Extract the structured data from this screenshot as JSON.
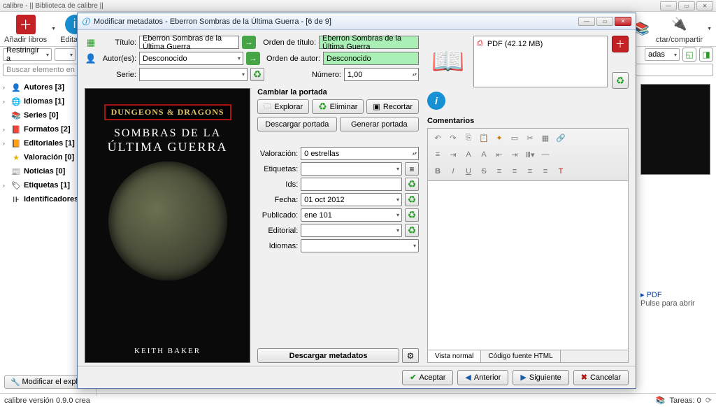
{
  "main_window": {
    "title": "calibre - || Biblioteca de calibre ||",
    "toolbar": {
      "add": "Añadir libros",
      "edit": "Editar m"
    },
    "subbar": {
      "restrict": "Restringir a",
      "search_placeholder": "Buscar elemento en el ..."
    },
    "sidebar": [
      {
        "icon": "👤",
        "label": "Autores [3]"
      },
      {
        "icon": "🌐",
        "label": "Idiomas [1]"
      },
      {
        "icon": "📚",
        "label": "Series [0]"
      },
      {
        "icon": "📕",
        "label": "Formatos [2]"
      },
      {
        "icon": "📙",
        "label": "Editoriales [1]"
      },
      {
        "icon": "⭐",
        "label": "Valoración [0]"
      },
      {
        "icon": "📢",
        "label": "Noticias [0]"
      },
      {
        "icon": "🏷",
        "label": "Etiquetas [1]"
      },
      {
        "icon": "⊪",
        "label": "Identificadores"
      }
    ],
    "modify_explorer": "Modificar el explorad",
    "status": "calibre versión 0.9.0 crea",
    "tasks": "Tareas: 0",
    "right_subbar": {
      "small_combo": "adas",
      "connect": "ctar/compartir"
    },
    "preview": {
      "format": "PDF",
      "hint": "Pulse para abrir"
    }
  },
  "dialog": {
    "title": "Modificar metadatos - Eberron Sombras de la Última Guerra -  [6 de 9]",
    "fields": {
      "title_label": "Título:",
      "title_value": "Eberron Sombras de la Última Guerra",
      "sort_title_label": "Orden de título:",
      "sort_title_value": "Eberron Sombras de la Última Guerra",
      "author_label": "Autor(es):",
      "author_value": "Desconocido",
      "sort_author_label": "Orden de autor:",
      "sort_author_value": "Desconocido",
      "series_label": "Serie:",
      "series_value": "",
      "number_label": "Número:",
      "number_value": "1,00"
    },
    "cover_section": "Cambiar la portada",
    "cover_btns": {
      "browse": "Explorar",
      "delete": "Eliminar",
      "trim": "Recortar",
      "download": "Descargar portada",
      "generate": "Generar portada"
    },
    "meta": {
      "rating_label": "Valoración:",
      "rating_value": "0 estrellas",
      "tags_label": "Etiquetas:",
      "tags_value": "",
      "ids_label": "Ids:",
      "ids_value": "",
      "date_label": "Fecha:",
      "date_value": "01 oct 2012",
      "pub_label": "Publicado:",
      "pub_value": "ene 101",
      "publisher_label": "Editorial:",
      "publisher_value": "",
      "lang_label": "Idiomas:",
      "lang_value": ""
    },
    "download_meta": "Descargar metadatos",
    "formats": {
      "pdf": "PDF (42.12 MB)"
    },
    "comments_label": "Comentarios",
    "tabs": {
      "normal": "Vista normal",
      "html": "Código fuente HTML"
    },
    "footer": {
      "accept": "Aceptar",
      "prev": "Anterior",
      "next": "Siguiente",
      "cancel": "Cancelar"
    },
    "cover": {
      "brand": "DUNGEONS & DRAGONS",
      "line1": "SOMBRAS DE LA",
      "line2": "ÚLTIMA GUERRA",
      "author": "KEITH BAKER"
    }
  }
}
